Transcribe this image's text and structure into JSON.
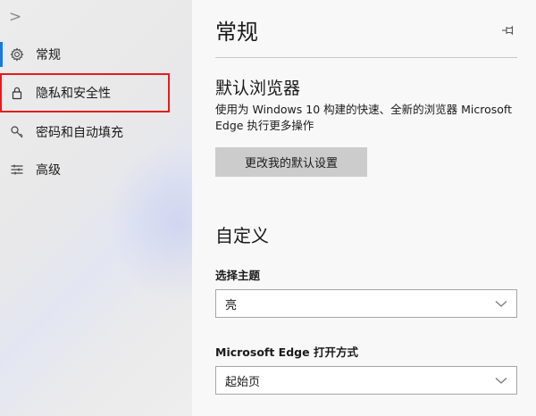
{
  "sidebar": {
    "back_glyph": ">",
    "items": [
      {
        "label": "常规",
        "icon": "gear-icon"
      },
      {
        "label": "隐私和安全性",
        "icon": "lock-icon"
      },
      {
        "label": "密码和自动填充",
        "icon": "key-icon"
      },
      {
        "label": "高级",
        "icon": "sliders-icon"
      }
    ]
  },
  "main": {
    "title": "常规",
    "default_browser": {
      "heading": "默认浏览器",
      "description": "使用为 Windows 10 构建的快速、全新的浏览器 Microsoft Edge 执行更多操作",
      "button_label": "更改我的默认设置"
    },
    "customize": {
      "heading": "自定义",
      "theme_label": "选择主题",
      "theme_value": "亮",
      "open_with_label": "Microsoft Edge 打开方式",
      "open_with_value": "起始页"
    }
  },
  "colors": {
    "accent": "#1a78d8",
    "highlight_box": "#e01e1e"
  }
}
